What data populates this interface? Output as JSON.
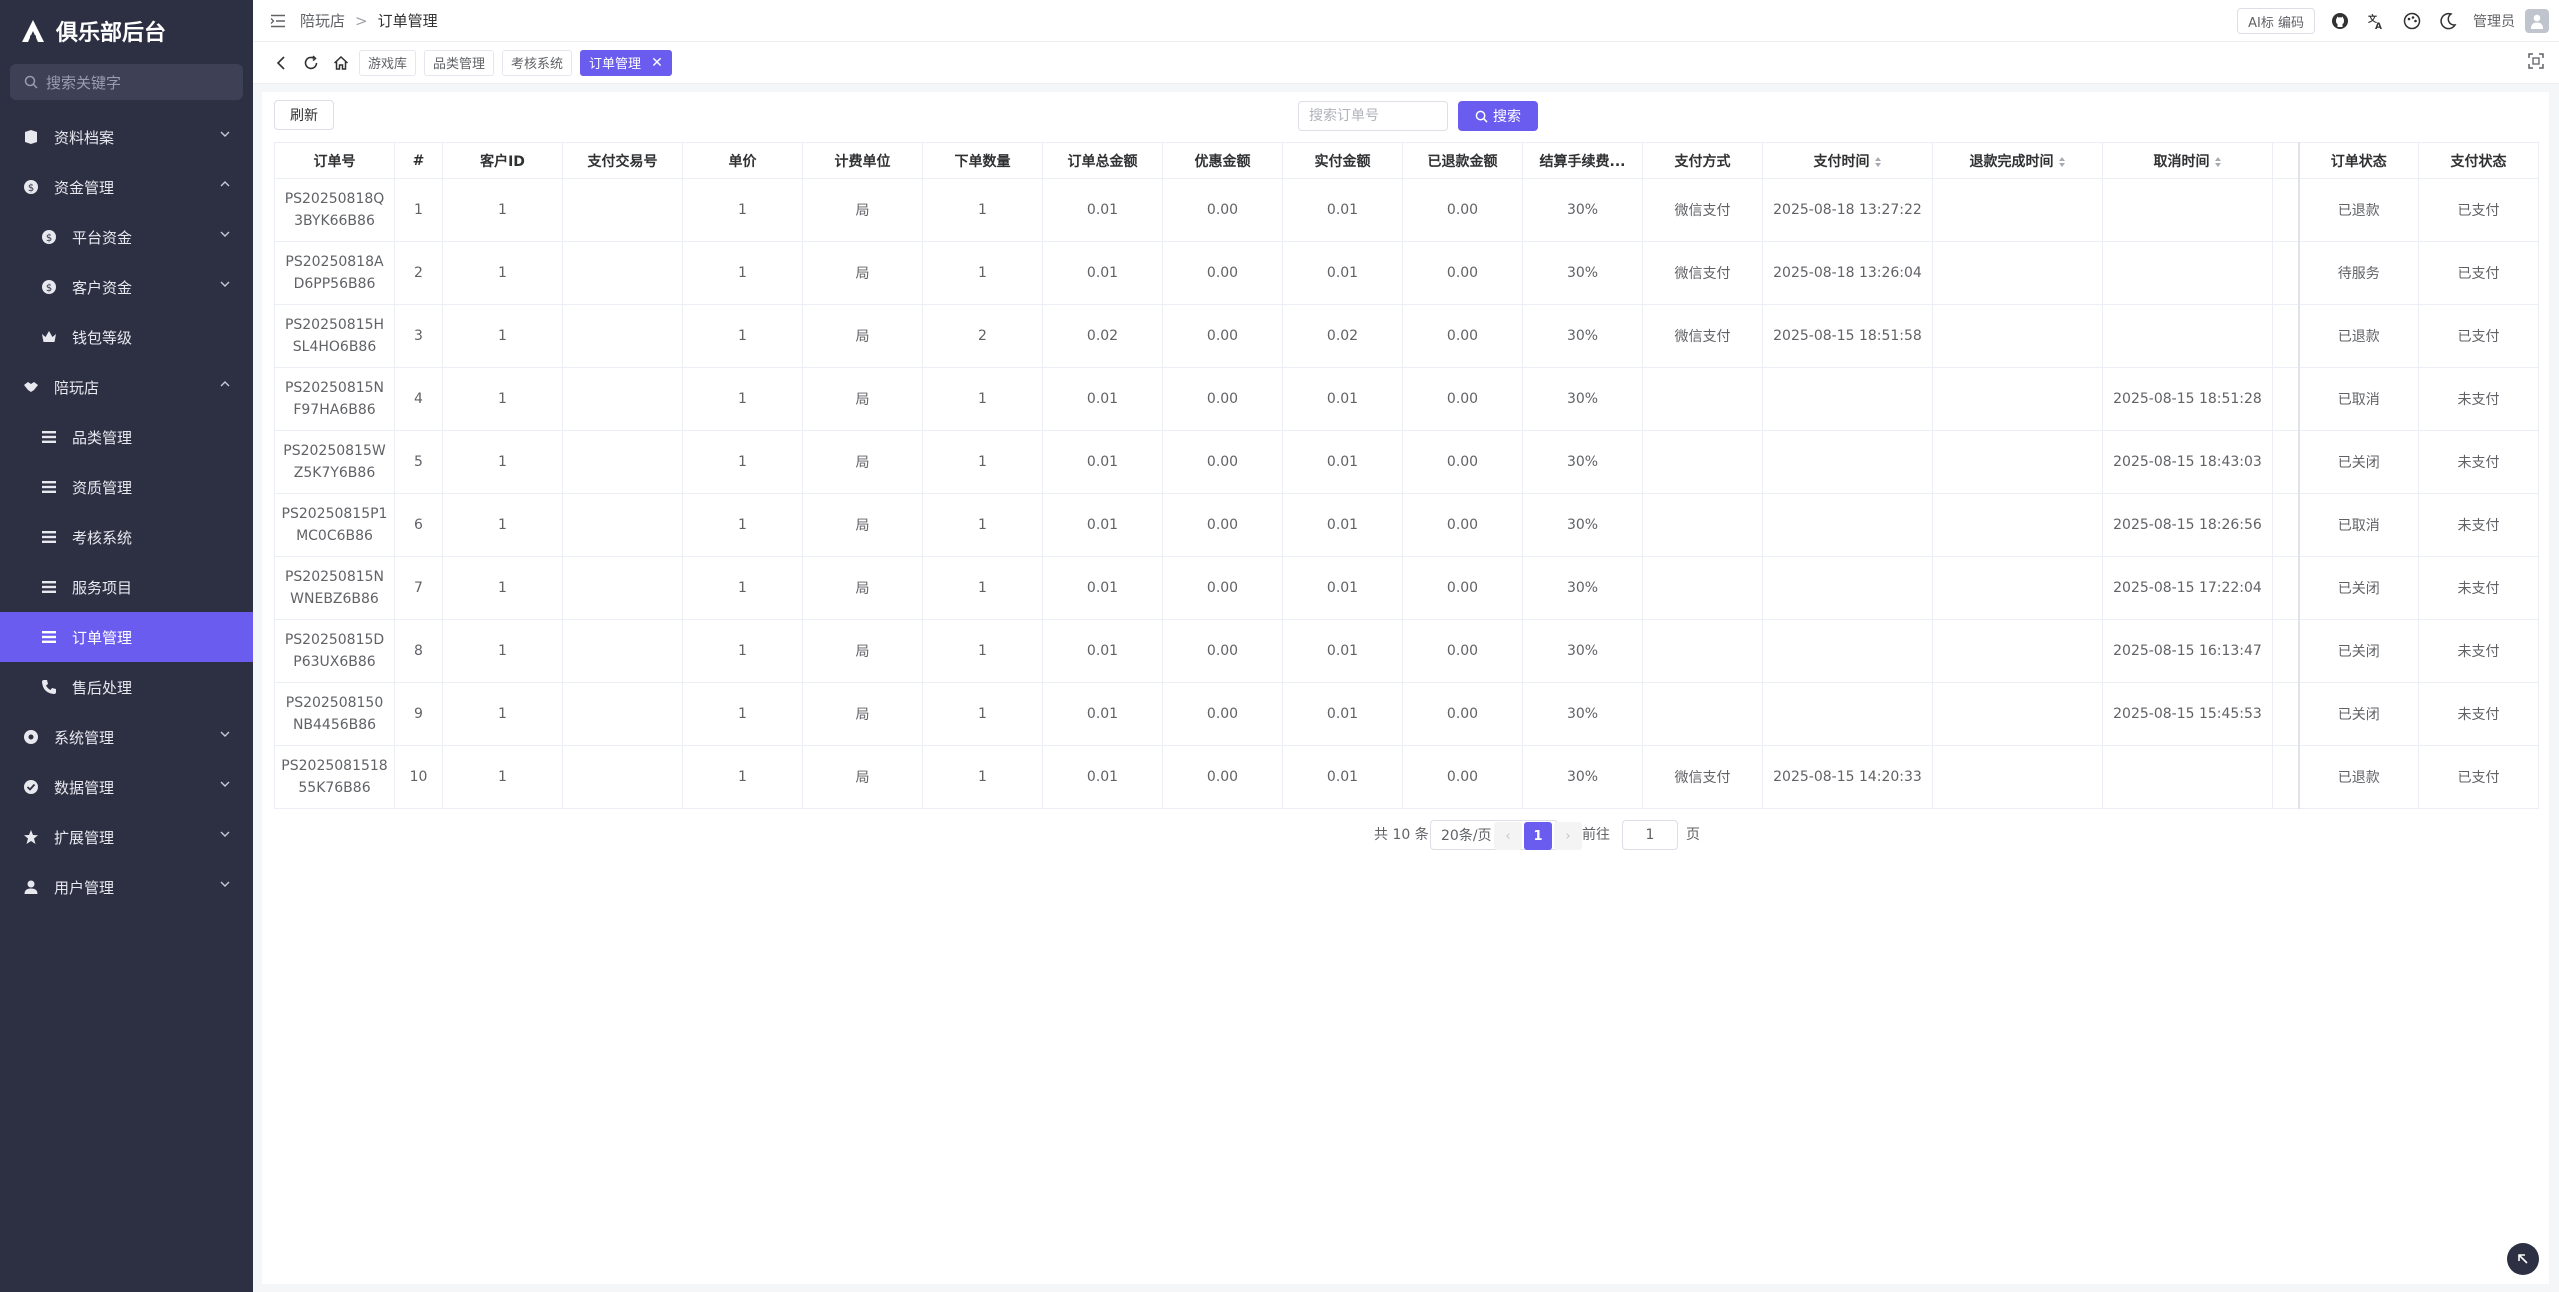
{
  "app": {
    "title": "俱乐部后台"
  },
  "sidebar": {
    "search_placeholder": "搜索关键字",
    "items": [
      {
        "label": "资料档案"
      },
      {
        "label": "资金管理"
      },
      {
        "label": "平台资金"
      },
      {
        "label": "客户资金"
      },
      {
        "label": "钱包等级"
      },
      {
        "label": "陪玩店"
      },
      {
        "label": "品类管理"
      },
      {
        "label": "资质管理"
      },
      {
        "label": "考核系统"
      },
      {
        "label": "服务项目"
      },
      {
        "label": "订单管理"
      },
      {
        "label": "售后处理"
      },
      {
        "label": "系统管理"
      },
      {
        "label": "数据管理"
      },
      {
        "label": "扩展管理"
      },
      {
        "label": "用户管理"
      }
    ],
    "active_color": "#6b5cf0"
  },
  "topbar": {
    "breadcrumb": [
      "陪玩店",
      "订单管理"
    ],
    "breadcrumb_sep": ">",
    "ai_label": "AI标 编码",
    "user_name": "管理员"
  },
  "tabs": {
    "items": [
      {
        "label": "游戏库"
      },
      {
        "label": "品类管理"
      },
      {
        "label": "考核系统"
      },
      {
        "label": "订单管理"
      }
    ],
    "active_index": 3,
    "close_glyph": "✕"
  },
  "toolbar": {
    "refresh_label": "刷新",
    "search_placeholder": "搜索订单号",
    "search_label": "搜索"
  },
  "table": {
    "headers": [
      "订单号",
      "#",
      "客户ID",
      "支付交易号",
      "单价",
      "计费单位",
      "下单数量",
      "订单总金额",
      "优惠金额",
      "实付金额",
      "已退款金额",
      "结算手续费...",
      "支付方式",
      "支付时间",
      "退款完成时间",
      "取消时间",
      "",
      "订单状态",
      "支付状态"
    ],
    "rows": [
      [
        "PS20250818Q3BYK66B86",
        "1",
        "1",
        "",
        "1",
        "局",
        "1",
        "0.01",
        "0.00",
        "0.01",
        "0.00",
        "30%",
        "微信支付",
        "2025-08-18 13:27:22",
        "",
        "",
        "",
        "已退款",
        "已支付"
      ],
      [
        "PS20250818AD6PP56B86",
        "2",
        "1",
        "",
        "1",
        "局",
        "1",
        "0.01",
        "0.00",
        "0.01",
        "0.00",
        "30%",
        "微信支付",
        "2025-08-18 13:26:04",
        "",
        "",
        "",
        "待服务",
        "已支付"
      ],
      [
        "PS20250815HSL4HO6B86",
        "3",
        "1",
        "",
        "1",
        "局",
        "2",
        "0.02",
        "0.00",
        "0.02",
        "0.00",
        "30%",
        "微信支付",
        "2025-08-15 18:51:58",
        "",
        "",
        "",
        "已退款",
        "已支付"
      ],
      [
        "PS20250815NF97HA6B86",
        "4",
        "1",
        "",
        "1",
        "局",
        "1",
        "0.01",
        "0.00",
        "0.01",
        "0.00",
        "30%",
        "",
        "",
        "",
        "2025-08-15 18:51:28",
        "",
        "已取消",
        "未支付"
      ],
      [
        "PS20250815WZ5K7Y6B86",
        "5",
        "1",
        "",
        "1",
        "局",
        "1",
        "0.01",
        "0.00",
        "0.01",
        "0.00",
        "30%",
        "",
        "",
        "",
        "2025-08-15 18:43:03",
        "",
        "已关闭",
        "未支付"
      ],
      [
        "PS20250815P1MC0C6B86",
        "6",
        "1",
        "",
        "1",
        "局",
        "1",
        "0.01",
        "0.00",
        "0.01",
        "0.00",
        "30%",
        "",
        "",
        "",
        "2025-08-15 18:26:56",
        "",
        "已取消",
        "未支付"
      ],
      [
        "PS20250815NWNEBZ6B86",
        "7",
        "1",
        "",
        "1",
        "局",
        "1",
        "0.01",
        "0.00",
        "0.01",
        "0.00",
        "30%",
        "",
        "",
        "",
        "2025-08-15 17:22:04",
        "",
        "已关闭",
        "未支付"
      ],
      [
        "PS20250815DP63UX6B86",
        "8",
        "1",
        "",
        "1",
        "局",
        "1",
        "0.01",
        "0.00",
        "0.01",
        "0.00",
        "30%",
        "",
        "",
        "",
        "2025-08-15 16:13:47",
        "",
        "已关闭",
        "未支付"
      ],
      [
        "PS202508150NB4456B86",
        "9",
        "1",
        "",
        "1",
        "局",
        "1",
        "0.01",
        "0.00",
        "0.01",
        "0.00",
        "30%",
        "",
        "",
        "",
        "2025-08-15 15:45:53",
        "",
        "已关闭",
        "未支付"
      ],
      [
        "PS202508151855K76B86",
        "10",
        "1",
        "",
        "1",
        "局",
        "1",
        "0.01",
        "0.00",
        "0.01",
        "0.00",
        "30%",
        "微信支付",
        "2025-08-15 14:20:33",
        "",
        "",
        "",
        "已退款",
        "已支付"
      ]
    ]
  },
  "pagination": {
    "total_label": "共 10 条",
    "page_size_label": "20条/页",
    "current_page": "1",
    "prev_glyph": "‹",
    "next_glyph": "›",
    "goto_label": "前往",
    "goto_value": "1",
    "page_suffix": "页"
  }
}
